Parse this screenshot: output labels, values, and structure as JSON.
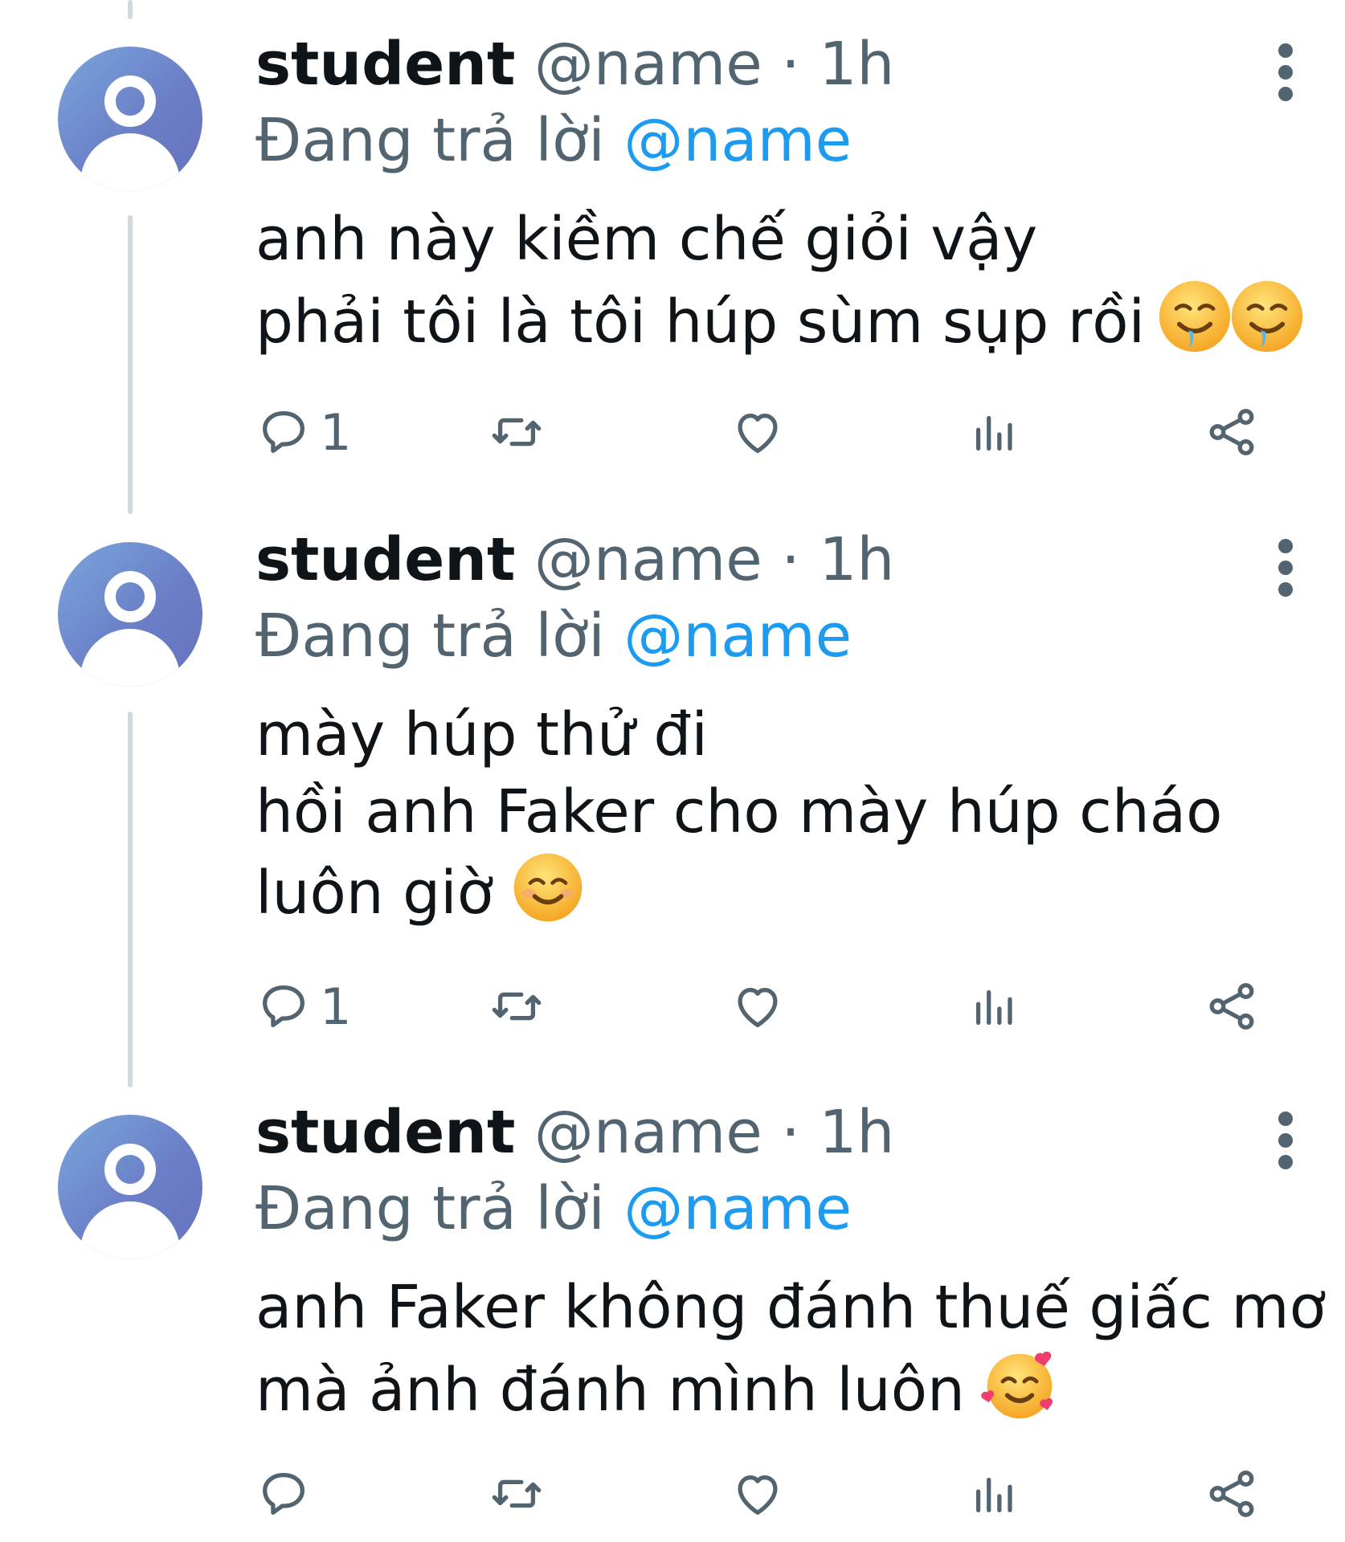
{
  "tweets": [
    {
      "display_name": "student",
      "handle": "@name",
      "separator": "·",
      "time": "1h",
      "replying_prefix": "Đang trả lời",
      "replying_to": "@name",
      "lines": [
        "anh này kiềm chế giỏi vậy",
        "phải tôi là tôi húp sùm sụp rồi"
      ],
      "emojis": [
        "drooling-face",
        "drooling-face"
      ],
      "reply_count": "1"
    },
    {
      "display_name": "student",
      "handle": "@name",
      "separator": "·",
      "time": "1h",
      "replying_prefix": "Đang trả lời",
      "replying_to": "@name",
      "lines": [
        "mày húp thử đi",
        "hồi anh Faker cho mày húp cháo",
        "luôn giờ"
      ],
      "emojis": [
        "smiling-face-with-smiling-eyes"
      ],
      "reply_count": "1"
    },
    {
      "display_name": "student",
      "handle": "@name",
      "separator": "·",
      "time": "1h",
      "replying_prefix": "Đang trả lời",
      "replying_to": "@name",
      "lines": [
        "anh Faker không đánh thuế giấc mơ",
        "mà ảnh đánh mình luôn"
      ],
      "emojis": [
        "smiling-face-with-hearts"
      ],
      "reply_count": ""
    }
  ],
  "colors": {
    "text": "#0f1419",
    "secondary": "#536471",
    "mention": "#1d9bf0",
    "thread_line": "#cfd9de"
  }
}
